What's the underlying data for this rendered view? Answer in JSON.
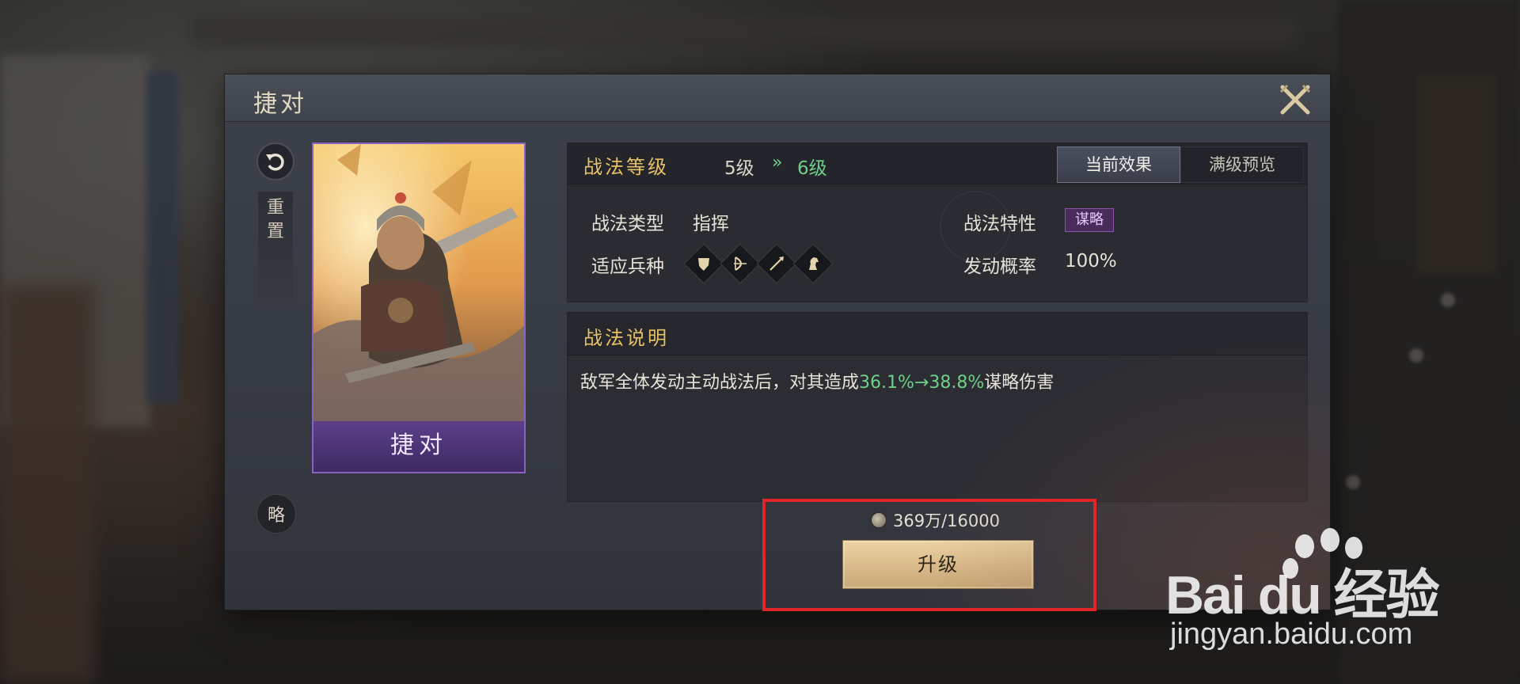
{
  "dialog": {
    "title": "捷对",
    "reset_label_1": "重",
    "reset_label_2": "置",
    "tactic_type_badge": "略"
  },
  "card": {
    "name": "捷对"
  },
  "info": {
    "level_title": "战法等级",
    "level_current": "5级",
    "level_arrow": "»",
    "level_next": "6级",
    "tabs": [
      {
        "label": "当前效果",
        "active": true
      },
      {
        "label": "满级预览",
        "active": false
      }
    ],
    "type_label": "战法类型",
    "type_value": "指挥",
    "trait_label": "战法特性",
    "trait_value": "谋略",
    "troops_label": "适应兵种",
    "troops": [
      "shield-icon",
      "bow-icon",
      "spear-icon",
      "horse-icon"
    ],
    "rate_label": "发动概率",
    "rate_value": "100%"
  },
  "desc": {
    "title": "战法说明",
    "text_before": "敌军全体发动主动战法后，对其造成",
    "text_highlight": "36.1%→38.8%",
    "text_after": "谋略伤害"
  },
  "upgrade": {
    "cost": "369万/16000",
    "button_label": "升级"
  },
  "watermark": {
    "brand": "Bai du 经验",
    "url": "jingyan.baidu.com"
  },
  "colors": {
    "gold": "#e8c067",
    "green": "#6fd08a",
    "purple": "#8a62c2",
    "highlight_red": "#e0262a"
  }
}
